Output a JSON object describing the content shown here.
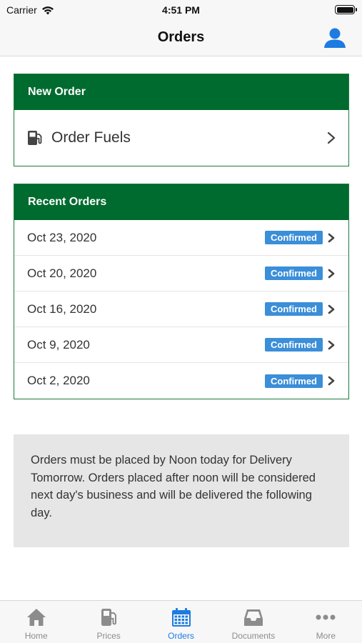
{
  "status_bar": {
    "carrier": "Carrier",
    "time": "4:51 PM"
  },
  "nav": {
    "title": "Orders"
  },
  "new_order": {
    "header": "New Order",
    "item_label": "Order Fuels"
  },
  "recent_orders": {
    "header": "Recent Orders",
    "items": [
      {
        "date": "Oct 23, 2020",
        "status": "Confirmed"
      },
      {
        "date": "Oct 20, 2020",
        "status": "Confirmed"
      },
      {
        "date": "Oct 16, 2020",
        "status": "Confirmed"
      },
      {
        "date": "Oct 9, 2020",
        "status": "Confirmed"
      },
      {
        "date": "Oct 2, 2020",
        "status": "Confirmed"
      }
    ]
  },
  "notice": {
    "text": "Orders must be placed by Noon today for Delivery Tomorrow. Orders placed after noon will be considered next day's business and will be delivered the following day."
  },
  "tabs": [
    {
      "label": "Home",
      "icon": "home-icon",
      "active": false
    },
    {
      "label": "Prices",
      "icon": "fuel-pump-icon",
      "active": false
    },
    {
      "label": "Orders",
      "icon": "calendar-icon",
      "active": true
    },
    {
      "label": "Documents",
      "icon": "inbox-icon",
      "active": false
    },
    {
      "label": "More",
      "icon": "ellipsis-icon",
      "active": false
    }
  ],
  "colors": {
    "header_green": "#006b2e",
    "border_green": "#1d7a3d",
    "badge_blue": "#3b8ed8",
    "active_tab_blue": "#1e7be0",
    "inactive_tab_gray": "#8c8c8c"
  }
}
